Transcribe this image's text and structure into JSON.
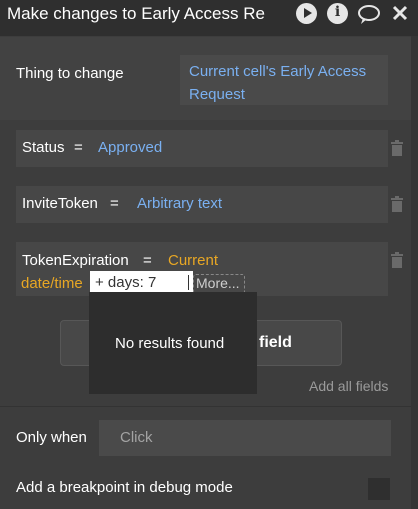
{
  "header": {
    "title": "Make changes to Early Access Re",
    "icons": [
      "play-icon",
      "info-icon",
      "comment-icon",
      "close-icon"
    ]
  },
  "thing": {
    "label": "Thing to change",
    "value_line1": "Current cell's Early Access",
    "value_line2": "Request"
  },
  "fields": [
    {
      "name": "Status",
      "equals": "=",
      "value": "Approved"
    },
    {
      "name": "InviteToken",
      "equals": "=",
      "value": "Arbitrary text"
    },
    {
      "name": "TokenExpiration",
      "equals": "=",
      "value_part1": "Current",
      "value_part2": "date/time",
      "operator": "+ days: 7",
      "more": "More..."
    }
  ],
  "dropdown": {
    "empty_text": "No results found"
  },
  "add_field": {
    "label_visible": "field"
  },
  "add_all_fields": "Add all fields",
  "only_when": {
    "label": "Only when",
    "placeholder": "Click"
  },
  "breakpoint": {
    "label": "Add a breakpoint in debug mode"
  },
  "colors": {
    "accent_blue": "#7ab0f1",
    "accent_orange": "#e8a724",
    "panel": "#3d3d3d"
  }
}
